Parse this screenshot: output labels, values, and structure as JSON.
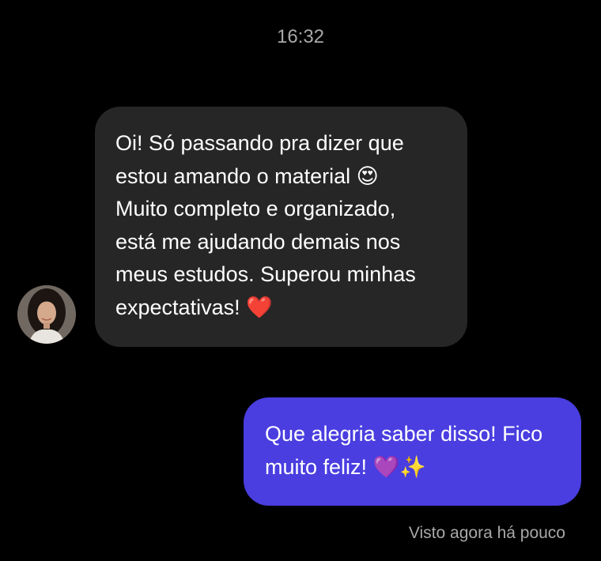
{
  "chat": {
    "time": "16:32",
    "incoming": {
      "text": "Oi! Só passando pra dizer que\nestou amando o material 😍\nMuito completo e organizado,\nestá me ajudando demais nos\nmeus estudos. Superou minhas\nexpectativas! ❤️",
      "avatar_icon": "profile-photo-woman"
    },
    "outgoing": {
      "text": "Que alegria saber disso! Fico\nmuito feliz! 💜✨"
    },
    "status": "Visto agora há pouco"
  },
  "colors": {
    "background": "#000000",
    "incoming_bubble": "#262626",
    "outgoing_bubble": "#4a3ee0",
    "meta_text": "#a8a8a8"
  }
}
